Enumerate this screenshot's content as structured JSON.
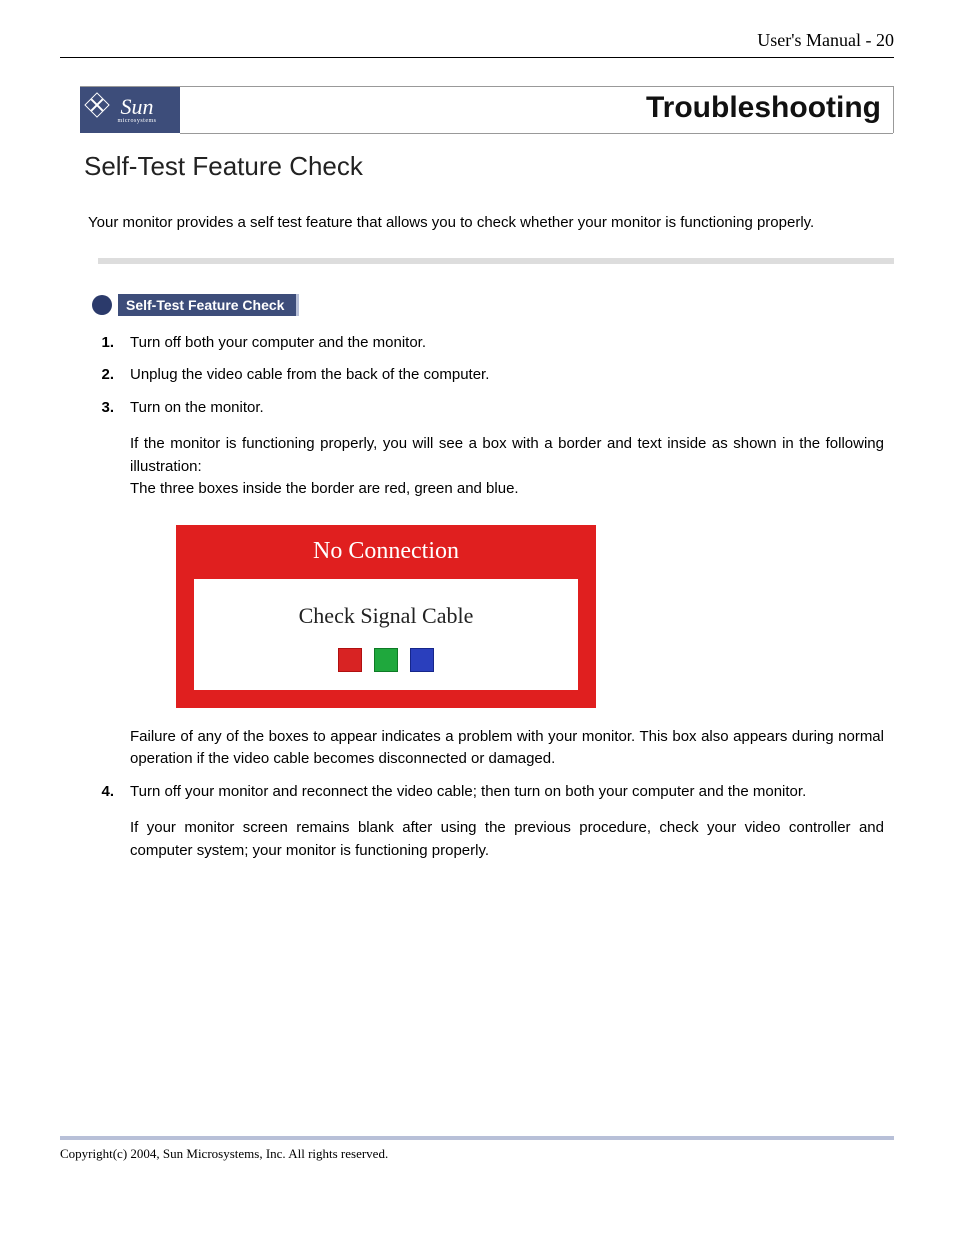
{
  "header": {
    "text": "User's Manual - 20"
  },
  "banner": {
    "logo_text": "Sun",
    "logo_sub": "microsystems",
    "title": "Troubleshooting"
  },
  "section_title": "Self-Test Feature Check",
  "intro": "Your monitor provides a self test feature that allows you to check whether your monitor is functioning properly.",
  "pill_label": "Self-Test Feature Check",
  "steps": {
    "s1": "Turn off both your computer and the monitor.",
    "s2": "Unplug the video cable from the back of the computer.",
    "s3": "Turn on the monitor.",
    "s3_p1": "If the monitor is functioning properly, you will see a box with a border and text inside as shown in the following illustration:",
    "s3_p2": "The three boxes inside the border are red, green and blue.",
    "s3_after": "Failure of any of the boxes to appear indicates a problem with your monitor. This box also appears during normal operation if the video cable becomes disconnected or damaged.",
    "s4": "Turn off your monitor and reconnect the video cable; then turn on both your computer and the monitor.",
    "s4_p1": "If your monitor screen remains blank after using the previous procedure, check your video controller and computer system; your monitor is functioning properly."
  },
  "illustration": {
    "heading": "No Connection",
    "caption": "Check Signal Cable"
  },
  "footer": "Copyright(c) 2004, Sun Microsystems, Inc. All rights reserved."
}
